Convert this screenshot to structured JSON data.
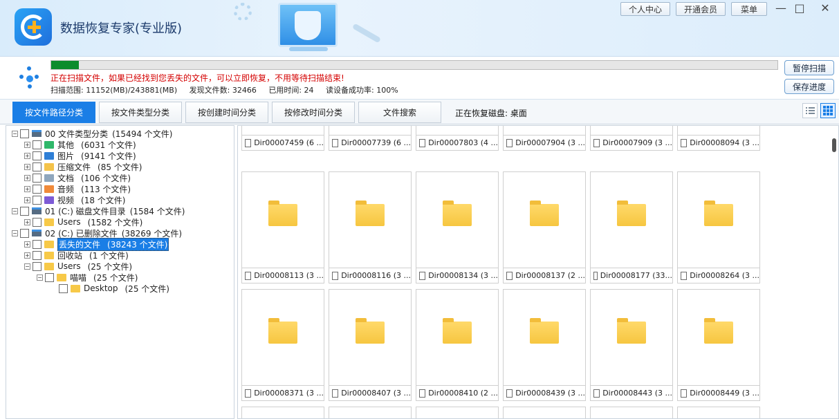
{
  "app": {
    "title": "数据恢复专家(专业版)",
    "header_buttons": [
      "个人中心",
      "开通会员",
      "菜单"
    ],
    "window_controls": [
      "—",
      "□",
      "✕"
    ]
  },
  "scan": {
    "progress_fraction": 0.038,
    "progress_color": "#0c8c2c",
    "message": "正在扫描文件，如果已经找到您丢失的文件，可以立即恢复，不用等待扫描结束!",
    "range": "扫描范围: 11152(MB)/243881(MB)",
    "found": "发现文件数: 32466",
    "elapsed": "已用时间: 24",
    "read_rate": "读设备成功率: 100%",
    "pause_label": "暂停扫描",
    "save_label": "保存进度"
  },
  "tabs": [
    {
      "label": "按文件路径分类",
      "active": true
    },
    {
      "label": "按文件类型分类",
      "active": false
    },
    {
      "label": "按创建时间分类",
      "active": false
    },
    {
      "label": "按修改时间分类",
      "active": false
    },
    {
      "label": "文件搜索",
      "active": false
    }
  ],
  "disk_status": "正在恢复磁盘: 桌面",
  "accent_color": "#1a7ee6",
  "tree": [
    {
      "label": "00 文件类型分类",
      "count": "(15494 个文件)",
      "level": 0,
      "icon": "drive-icon"
    },
    {
      "label": "其他",
      "count": "(6031 个文件)",
      "level": 1,
      "icon": "other-folder-icon"
    },
    {
      "label": "图片",
      "count": "(9141 个文件)",
      "level": 1,
      "icon": "image-icon"
    },
    {
      "label": "压缩文件",
      "count": "(85 个文件)",
      "level": 1,
      "icon": "archive-icon"
    },
    {
      "label": "文档",
      "count": "(106 个文件)",
      "level": 1,
      "icon": "document-icon"
    },
    {
      "label": "音频",
      "count": "(113 个文件)",
      "level": 1,
      "icon": "audio-icon"
    },
    {
      "label": "视频",
      "count": "(18 个文件)",
      "level": 1,
      "icon": "video-icon"
    },
    {
      "label": "01 (C:) 磁盘文件目录",
      "count": "(1584 个文件)",
      "level": 0,
      "icon": "drive-icon"
    },
    {
      "label": "Users",
      "count": "(1582 个文件)",
      "level": 1,
      "icon": "folder-icon"
    },
    {
      "label": "02 (C:) 已删除文件",
      "count": "(38269 个文件)",
      "level": 0,
      "icon": "drive-icon"
    },
    {
      "label": "丢失的文件",
      "count": "(38243 个文件)",
      "level": 1,
      "icon": "folder-icon",
      "selected": true
    },
    {
      "label": "回收站",
      "count": "(1 个文件)",
      "level": 1,
      "icon": "folder-icon"
    },
    {
      "label": "Users",
      "count": "(25 个文件)",
      "level": 1,
      "icon": "folder-icon"
    },
    {
      "label": "喵喵",
      "count": "(25 个文件)",
      "level": 2,
      "icon": "folder-icon"
    },
    {
      "label": "Desktop",
      "count": "(25 个文件)",
      "level": 3,
      "icon": "folder-icon"
    }
  ],
  "grid_rows": [
    [
      "Dir00007459 (6 ...",
      "Dir00007739 (6 ...",
      "Dir00007803 (4 ...",
      "Dir00007904 (3 ...",
      "Dir00007909 (3 ...",
      "Dir00008094 (3 ..."
    ],
    [
      "Dir00008113 (3 ...",
      "Dir00008116 (3 ...",
      "Dir00008134 (3 ...",
      "Dir00008137 (2 ...",
      "Dir00008177 (33...",
      "Dir00008264 (3 ..."
    ],
    [
      "Dir00008371 (3 ...",
      "Dir00008407 (3 ...",
      "Dir00008410 (2 ...",
      "Dir00008439 (3 ...",
      "Dir00008443 (3 ...",
      "Dir00008449 (3 ..."
    ]
  ]
}
